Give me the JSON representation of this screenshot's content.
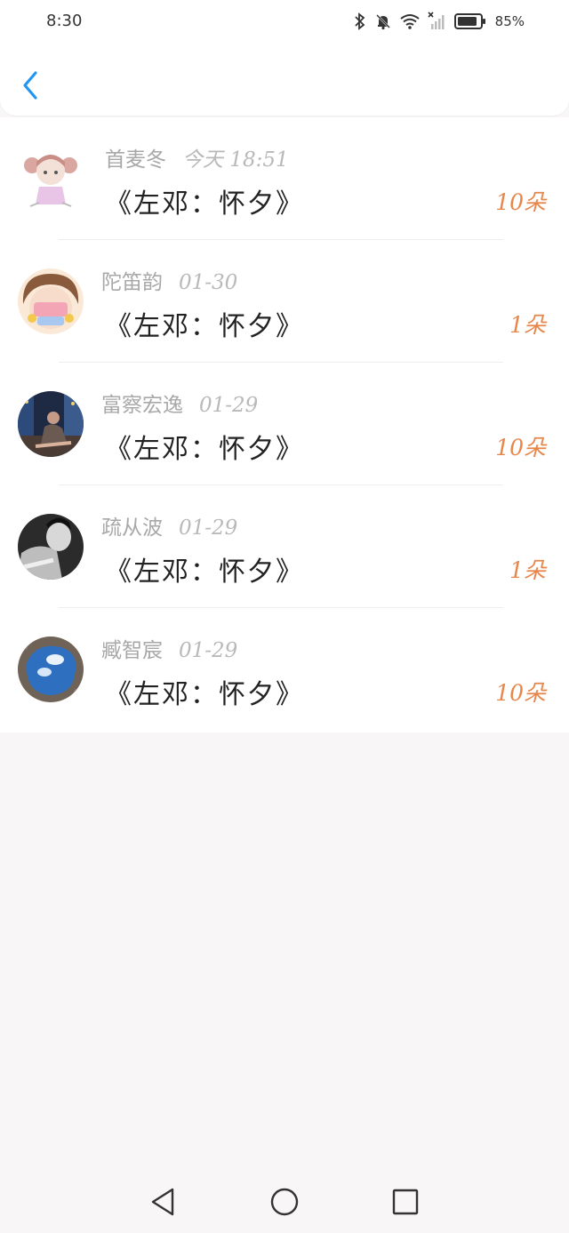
{
  "status_bar": {
    "time": "8:30",
    "battery": "85%",
    "icons": [
      "bluetooth-icon",
      "mute-bell-icon",
      "wifi-icon",
      "no-signal-icon",
      "battery-icon"
    ]
  },
  "header": {
    "back_icon": "chevron-left-icon",
    "accent": "#2196f3"
  },
  "records": [
    {
      "name": "首麦冬",
      "date": "今天 18:51",
      "title": "《左邓：怀夕》",
      "count": "10朵"
    },
    {
      "name": "陀笛韵",
      "date": "01-30",
      "title": "《左邓：怀夕》",
      "count": "1朵"
    },
    {
      "name": "富察宏逸",
      "date": "01-29",
      "title": "《左邓：怀夕》",
      "count": "10朵"
    },
    {
      "name": "疏从波",
      "date": "01-29",
      "title": "《左邓：怀夕》",
      "count": "1朵"
    },
    {
      "name": "臧智宸",
      "date": "01-29",
      "title": "《左邓：怀夕》",
      "count": "10朵"
    }
  ],
  "colors": {
    "count": "#e8864a",
    "name": "#a8a8a8",
    "title": "#222222"
  },
  "navigation": [
    "back-triangle-icon",
    "home-circle-icon",
    "recents-square-icon"
  ]
}
